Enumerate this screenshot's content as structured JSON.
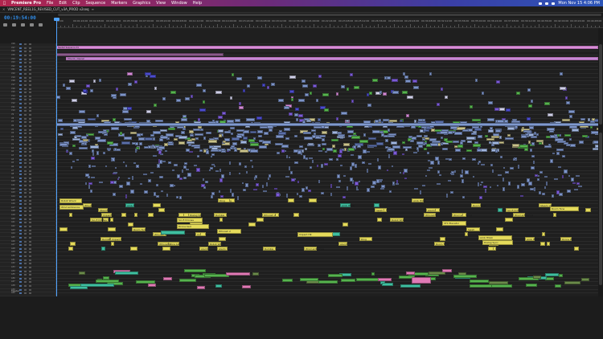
{
  "mac_menubar": {
    "apple": "",
    "items": [
      "Premiere Pro",
      "File",
      "Edit",
      "Clip",
      "Sequence",
      "Markers",
      "Graphics",
      "View",
      "Window",
      "Help"
    ],
    "clock": "Mon Nov 15  4:06 PM"
  },
  "panel": {
    "sequence_tab": "VINCENT_REEL1G_REVISED_CUT_v3A_PROD v2seq",
    "close_glyph": "✕",
    "menu_glyph": "≡"
  },
  "timecode": "00:19:54:00",
  "ruler": {
    "ticks": [
      "00:00",
      "00:01:24:00",
      "00:02:48:00",
      "00:04:12:00",
      "00:05:36:00",
      "00:07:00:00",
      "00:08:24:00",
      "00:09:48:00",
      "00:11:12:00",
      "00:12:36:00",
      "00:14:00:00",
      "00:15:24:00",
      "00:16:48:00",
      "00:18:12:00",
      "00:19:36:00",
      "00:21:00:00",
      "00:22:24:00",
      "00:23:48:00",
      "00:25:12:00",
      "00:26:36:00",
      "00:28:00:00",
      "00:29:24:00",
      "00:30:48:00",
      "00:32:12:00",
      "00:33:36:00",
      "00:35:00:00",
      "00:36:24:00",
      "00:37:48:00",
      "00:39:12:00",
      "00:40:36:00",
      "00:42:00:00",
      "00:43:24:00",
      "00:44:48:00"
    ]
  },
  "track_headers": {
    "video": [
      "V28",
      "V27",
      "V26",
      "V25",
      "V24",
      "V23",
      "V22",
      "V21",
      "V20",
      "V19",
      "V18",
      "V17",
      "V16",
      "V15",
      "V14",
      "V13",
      "V12",
      "V11",
      "V10",
      "V9",
      "V8",
      "V7",
      "V6",
      "V5",
      "V4",
      "V3",
      "V2",
      "V1"
    ],
    "audio": [
      "A1",
      "A2",
      "A3",
      "A4",
      "A5",
      "A6",
      "A7",
      "A8",
      "A9",
      "A10",
      "A11",
      "A12",
      "A13",
      "A14",
      "A15",
      "A16",
      "A17",
      "A18",
      "A19",
      "A20",
      "A21",
      "A22",
      "A23",
      "A24",
      "A25",
      "A26",
      "A27",
      "A28",
      "A29",
      "A30",
      "A31",
      "A32",
      "A33",
      "A34",
      "A35",
      "A36",
      "A37",
      "A38",
      "A39",
      "A40"
    ],
    "master": "Master"
  },
  "title_clips": [
    {
      "label": "Nested Sequence 01"
    },
    {
      "label": "Title 01 | Opener"
    }
  ],
  "audio_labels": [
    "Robot Wreck",
    "Wind ambience",
    "Sci-fi Drones",
    "Drone bed",
    "Impact Hit",
    "SFX Elevator",
    "Amb HVAC",
    "Dialog Sync",
    "Room Tone",
    "Whoosh 2",
    "Swell",
    "Rumble",
    "Steam Vent",
    "Alarm",
    "Ding"
  ],
  "colors": {
    "accent_blue": "#2f8ce8",
    "video_clip": "#7d94c8",
    "video_clip_dark": "#5a6ea8",
    "purple": "#7b5bd6",
    "magenta": "#d98fd8",
    "green": "#56b34e",
    "yellow_audio": "#e5db5b",
    "teal": "#3fbfa0",
    "pink": "#e07ab5"
  }
}
